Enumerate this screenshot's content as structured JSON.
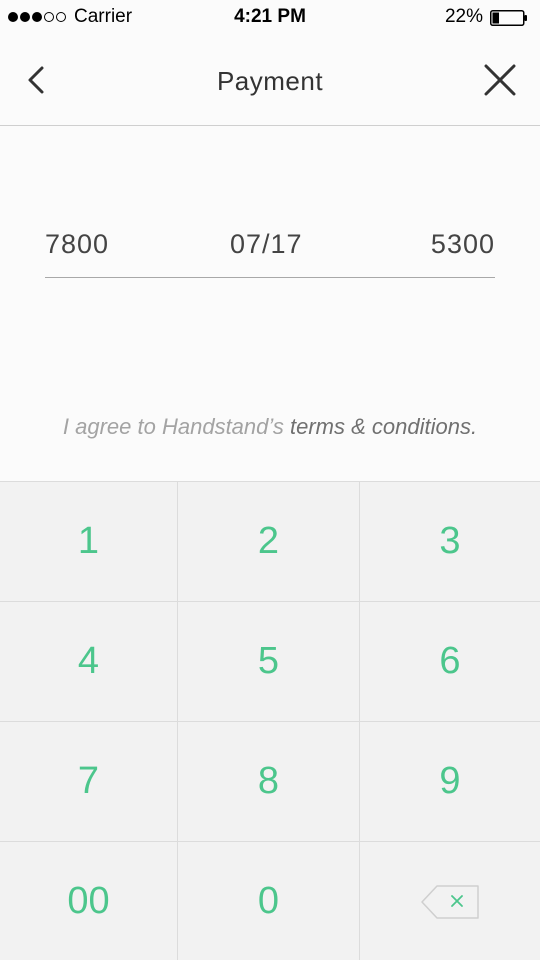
{
  "status_bar": {
    "carrier": "Carrier",
    "time": "4:21 PM",
    "battery_percent": "22%",
    "signal_filled": 3,
    "signal_empty": 2,
    "battery_level": 0.22
  },
  "nav": {
    "title": "Payment",
    "back_icon": "chevron-left-icon",
    "close_icon": "close-icon"
  },
  "card": {
    "number": "7800",
    "expiry": "07/17",
    "cvv": "5300"
  },
  "terms": {
    "prefix": "I agree to Handstand’s ",
    "link": "terms & conditions."
  },
  "keypad": {
    "keys": [
      "1",
      "2",
      "3",
      "4",
      "5",
      "6",
      "7",
      "8",
      "9",
      "00",
      "0"
    ],
    "delete_icon": "backspace-icon",
    "accent_color": "#4cc68c"
  }
}
